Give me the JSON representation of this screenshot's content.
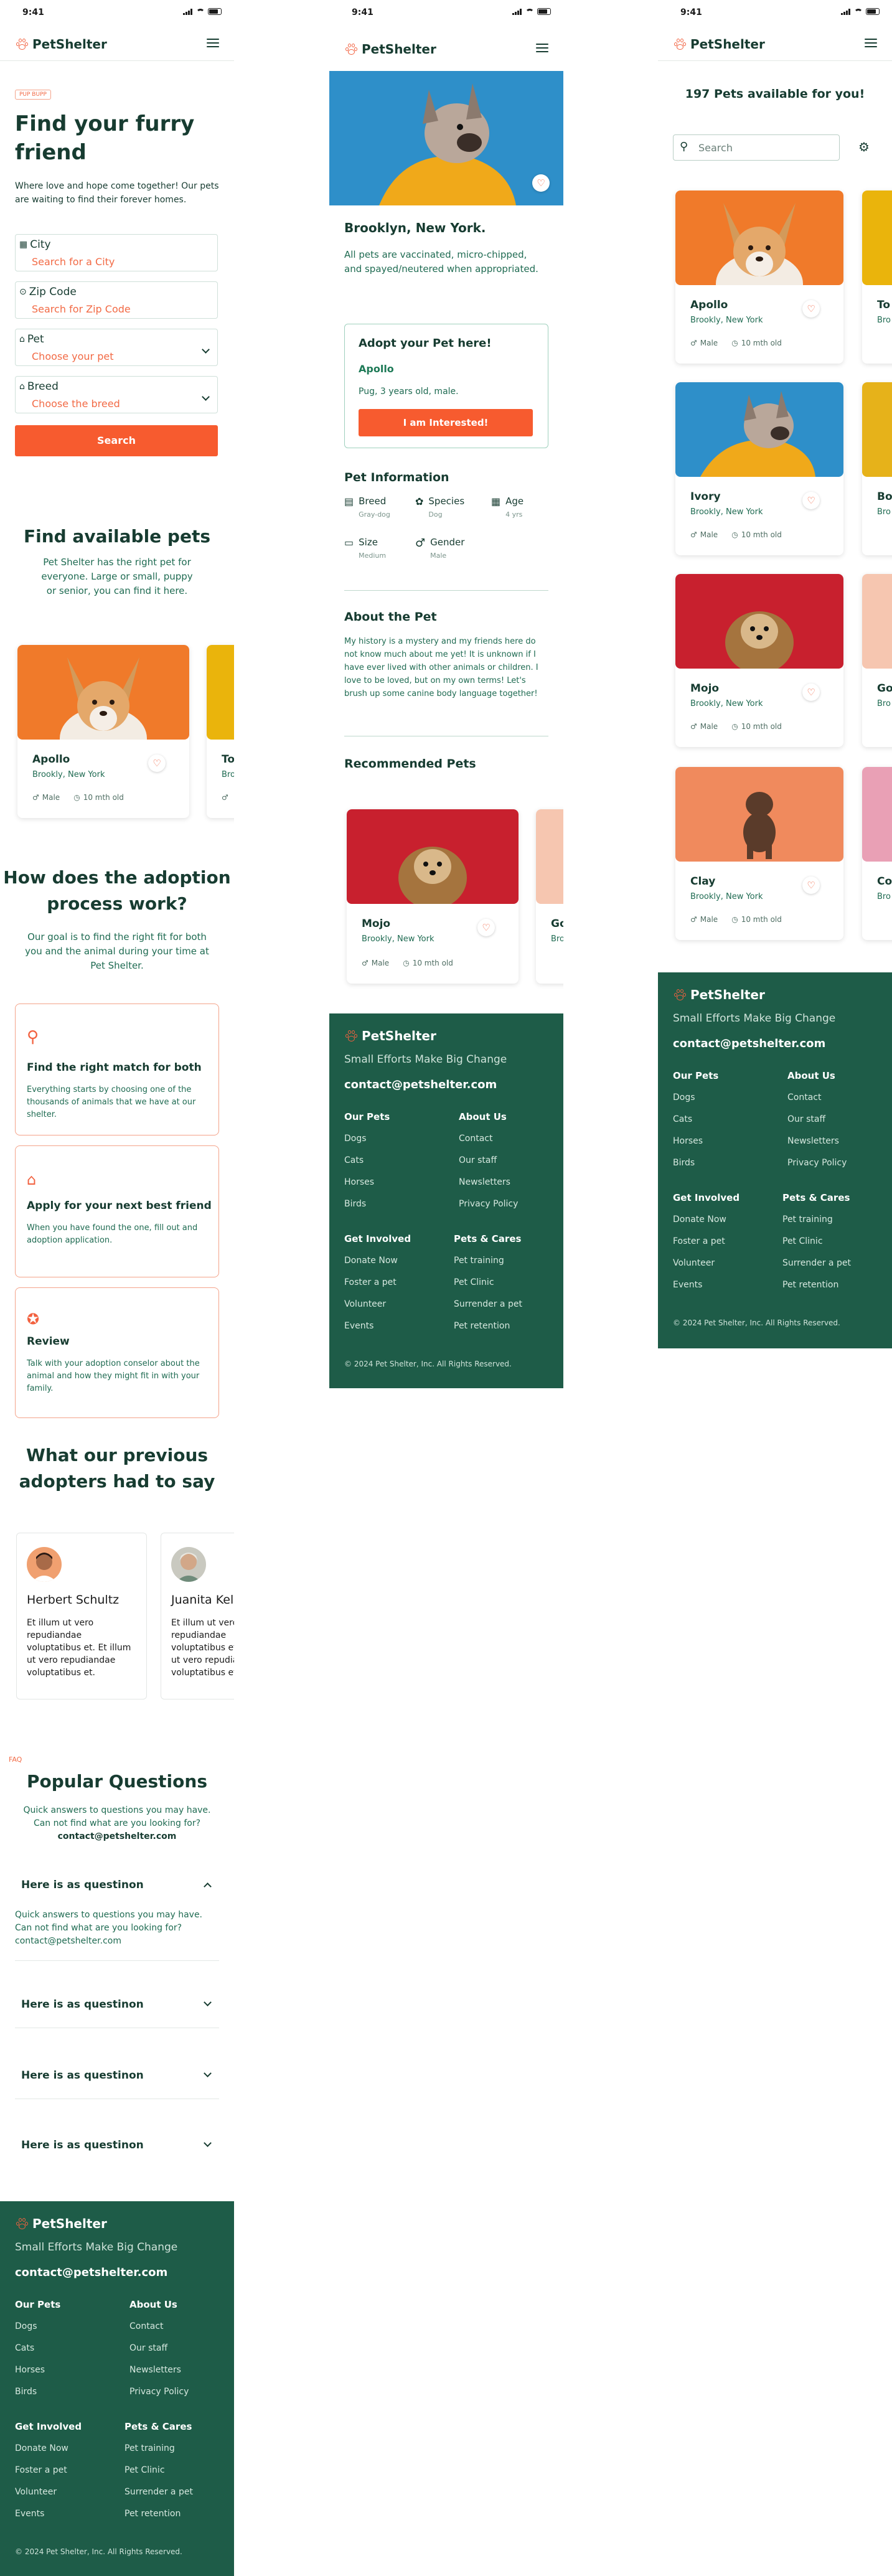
{
  "status": {
    "time": "9:41"
  },
  "brand": {
    "name": "PetShelter",
    "accent": "#f75b2f",
    "dark_green": "#1e5c48"
  },
  "home": {
    "badge": "PUP BUPP",
    "title_line1": "Find your  furry",
    "title_line2": "friend",
    "intro": "Where love and hope come together! Our pets are waiting to find their forever homes.",
    "form": {
      "city": {
        "label": "City",
        "placeholder": "Search for a City"
      },
      "zip": {
        "label": "Zip Code",
        "placeholder": "Search for Zip Code"
      },
      "pet": {
        "label": "Pet",
        "placeholder": "Choose your pet"
      },
      "breed": {
        "label": "Breed",
        "placeholder": "Choose the breed"
      },
      "search_label": "Search"
    },
    "available": {
      "title": "Find available pets",
      "text": "Pet Shelter has the right pet for everyone. Large or small, puppy or senior, you can find it here."
    },
    "process": {
      "title_line1": "How does the adoption",
      "title_line2": "process work?",
      "text": "Our goal is to find the right fit for both you and the animal during your time at Pet Shelter.",
      "steps": [
        {
          "icon": "search-icon",
          "title": "Find the right match for both",
          "text": "Everything starts by choosing one of the thousands of animals that we have at our shelter."
        },
        {
          "icon": "home-icon",
          "title": "Apply for your next best friend",
          "text": "When you have found the one, fill out and adoption application."
        },
        {
          "icon": "award-icon",
          "title": "Review",
          "text": "Talk with your adoption conselor about the animal and how they might fit in with your family."
        }
      ]
    },
    "testimonials": {
      "title_line1": "What our previous",
      "title_line2": "adopters had to say",
      "items": [
        {
          "name": "Herbert Schultz",
          "text": "Et illum ut vero repudiandae voluptatibus et. Et illum ut vero repudiandae voluptatibus et."
        },
        {
          "name": "Juanita Kelly",
          "text": "Et illum ut vero repudiandae voluptatibus et. Et illum ut vero repudiandae voluptatibus et."
        }
      ]
    },
    "faq": {
      "eyebrow": "FAQ",
      "title": "Popular Questions",
      "text": "Quick answers to questions you may have. Can not find what are you looking for?",
      "email": "contact@petshelter.com",
      "items": [
        {
          "question": "Here is as questinon",
          "answer": "Quick answers to questions you may have. Can not find what are you looking for? contact@petshelter.com"
        },
        {
          "question": "Here is as questinon"
        },
        {
          "question": "Here is as questinon"
        },
        {
          "question": "Here is as questinon"
        }
      ]
    }
  },
  "pets": [
    {
      "name": "Apollo",
      "location": "Brookly, New York",
      "gender": "Male",
      "age": "10 mth old"
    },
    {
      "name": "Ivory",
      "location": "Brookly, New York",
      "gender": "Male",
      "age": "10 mth old"
    },
    {
      "name": "Mojo",
      "location": "Brookly, New York",
      "gender": "Male",
      "age": "10 mth old"
    },
    {
      "name": "Clay",
      "location": "Brookly, New York",
      "gender": "Male",
      "age": "10 mth old"
    },
    {
      "name": "To",
      "location": "Bro"
    },
    {
      "name": "Bo",
      "location": "Bro"
    },
    {
      "name": "Go",
      "location": "Bro"
    },
    {
      "name": "Co",
      "location": "Bro"
    }
  ],
  "detail": {
    "location": "Brooklyn,  New York.",
    "text": "All pets are vaccinated, micro-chipped, and spayed/neutered when appropriated.",
    "adopt": {
      "title": "Adopt your Pet here!",
      "name": "Apollo",
      "desc": "Pug, 3 years old, male.",
      "button": "I am Interested!"
    },
    "info_title": "Pet Information",
    "info": [
      {
        "label": "Breed",
        "value": "Gray-dog"
      },
      {
        "label": "Species",
        "value": "Dog"
      },
      {
        "label": "Age",
        "value": "4 yrs"
      },
      {
        "label": "Size",
        "value": "Medium"
      },
      {
        "label": "Gender",
        "value": "Male"
      }
    ],
    "about_title": "About the Pet",
    "about_text": "My history is a mystery and my friends here do not know much about me yet! It is unknown if I have ever lived with other animals or children. I love to be loved, but on my own terms! Let's brush up some canine body language together!",
    "recommended_title": "Recommended Pets"
  },
  "list": {
    "title": "197 Pets available for you!",
    "search_placeholder": "Search"
  },
  "footer": {
    "tagline": "Small Efforts Make Big Change",
    "email": "contact@petshelter.com",
    "our_pets": {
      "title": "Our Pets",
      "links": [
        "Dogs",
        "Cats",
        "Horses",
        "Birds"
      ]
    },
    "about": {
      "title": "About Us",
      "links": [
        "Contact",
        "Our staff",
        "Newsletters",
        "Privacy Policy"
      ]
    },
    "involved": {
      "title": "Get Involved",
      "links": [
        "Donate Now",
        "Foster a pet",
        "Volunteer",
        "Events"
      ]
    },
    "cares": {
      "title": "Pets & Cares",
      "links": [
        "Pet training",
        "Pet Clinic",
        "Surrender a pet",
        "Pet retention"
      ]
    },
    "copyright": "© 2024 Pet Shelter, Inc. All Rights Reserved."
  }
}
